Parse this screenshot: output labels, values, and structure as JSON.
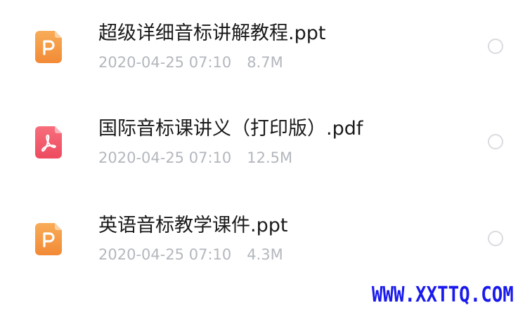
{
  "files": [
    {
      "name": "超级详细音标讲解教程.ppt",
      "date": "2020-04-25 07:10",
      "size": "8.7M",
      "icon": "ppt-file-icon",
      "icon_color": "#f59b46",
      "selected": false
    },
    {
      "name": "国际音标课讲义（打印版）.pdf",
      "date": "2020-04-25 07:10",
      "size": "12.5M",
      "icon": "pdf-file-icon",
      "icon_color": "#f0566a",
      "selected": false
    },
    {
      "name": "英语音标教学课件.ppt",
      "date": "2020-04-25 07:10",
      "size": "4.3M",
      "icon": "ppt-file-icon",
      "icon_color": "#f59b46",
      "selected": false
    }
  ],
  "watermark": {
    "text": "WWW.XXTTQ.COM",
    "color": "#1a1aee"
  }
}
